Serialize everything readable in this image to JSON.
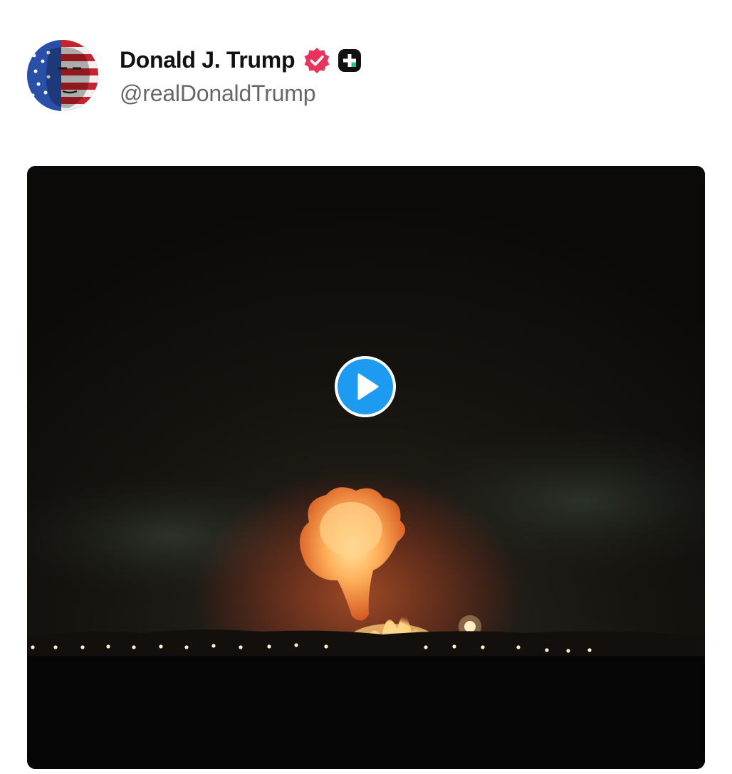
{
  "post": {
    "author": {
      "display_name": "Donald J. Trump",
      "handle": "@realDonaldTrump",
      "avatar_icon": "flag-portrait-avatar",
      "verified_icon": "verified-badge-icon",
      "verified_color": "#e8335f",
      "badge_icon": "plus-badge-icon"
    },
    "media": {
      "type": "video",
      "play_icon": "play-icon",
      "play_color": "#1d9bf0"
    }
  }
}
